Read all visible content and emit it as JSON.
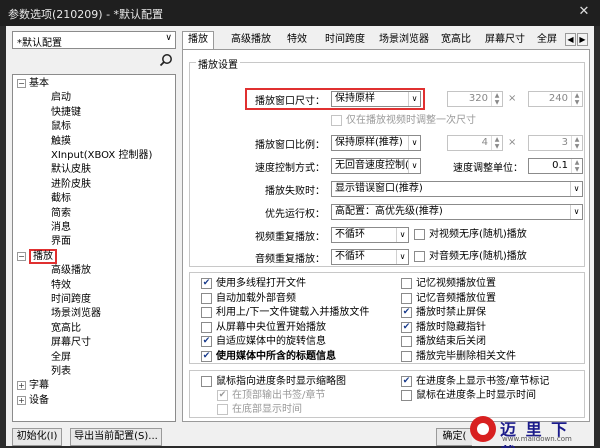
{
  "window": {
    "title": "参数选项(210209) - *默认配置",
    "close": "✕"
  },
  "left": {
    "preset": "*默认配置",
    "search_icon": "search-icon",
    "tree": [
      {
        "label": "基本",
        "expander": "−"
      },
      {
        "label": "启动"
      },
      {
        "label": "快捷键"
      },
      {
        "label": "鼠标"
      },
      {
        "label": "触摸"
      },
      {
        "label": "XInput(XBOX 控制器)"
      },
      {
        "label": "默认皮肤"
      },
      {
        "label": "进阶皮肤"
      },
      {
        "label": "截标"
      },
      {
        "label": "简索"
      },
      {
        "label": "消息"
      },
      {
        "label": "界面"
      },
      {
        "label": "播放",
        "expander": "−",
        "selected": true
      },
      {
        "label": "高级播放"
      },
      {
        "label": "特效"
      },
      {
        "label": "时间跨度"
      },
      {
        "label": "场景浏览器"
      },
      {
        "label": "宽高比"
      },
      {
        "label": "屏幕尺寸"
      },
      {
        "label": "全屏"
      },
      {
        "label": "列表"
      },
      {
        "label": "字幕",
        "expander": "+"
      },
      {
        "label": "设备",
        "expander": "+"
      }
    ]
  },
  "buttons": {
    "init": "初始化(I)",
    "export": "导出当前配置(S)...",
    "ok": "确定("
  },
  "tabs": [
    "播放",
    "高级播放",
    "特效",
    "时间跨度",
    "场景浏览器",
    "宽高比",
    "屏幕尺寸",
    "全屏"
  ],
  "tab_scroll": {
    "left": "◀",
    "right": "▶"
  },
  "settings": {
    "legend": "播放设置",
    "window_size_label": "播放窗口尺寸：",
    "window_size_value": "保持原样",
    "width": "320",
    "height": "240",
    "times": "×",
    "only_when_video": "仅在播放视频时调整一次尺寸",
    "ratio_label": "播放窗口比例：",
    "ratio_value": "保持原样(推荐)",
    "ratio_a": "4",
    "ratio_b": "3",
    "speed_label": "速度控制方式：",
    "speed_value": "无回音速度控制(",
    "speed_unit_label": "速度调整单位：",
    "speed_unit_value": "0.1",
    "fail_label": "播放失败时：",
    "fail_value": "显示错误窗口(推荐)",
    "priority_label": "优先运行权：",
    "priority_value": "高配置：高优先级(推荐)",
    "video_repeat_label": "视频重复播放：",
    "video_repeat_value": "不循环",
    "video_shuffle": "对视频无序(随机)播放",
    "audio_repeat_label": "音频重复播放：",
    "audio_repeat_value": "不循环",
    "audio_shuffle": "对音频无序(随机)播放",
    "arrow": "∨"
  },
  "options_left": [
    {
      "label": "使用多线程打开文件",
      "checked": true
    },
    {
      "label": "自动加载外部音频",
      "checked": false
    },
    {
      "label": "利用上/下一文件键载入并播放文件",
      "checked": false
    },
    {
      "label": "从屏幕中央位置开始播放",
      "checked": false
    },
    {
      "label": "自适应媒体中的旋转信息",
      "checked": true
    },
    {
      "label": "使用媒体中所含的标题信息",
      "checked": true,
      "bold": true
    }
  ],
  "options_right": [
    {
      "label": "记忆视频播放位置",
      "checked": false
    },
    {
      "label": "记忆音频播放位置",
      "checked": false
    },
    {
      "label": "播放时禁止屏保",
      "checked": true
    },
    {
      "label": "播放时隐藏指针",
      "checked": true
    },
    {
      "label": "播放结束后关闭",
      "checked": false
    },
    {
      "label": "播放完毕删除相关文件",
      "checked": false
    }
  ],
  "seek_options": [
    {
      "label": "鼠标指向进度条时显示缩略图",
      "checked": false
    },
    {
      "label": "在顶部输出书签/章节",
      "checked": true,
      "disabled": true
    },
    {
      "label": "在底部显示时间",
      "checked": false,
      "disabled": true
    },
    {
      "label": "在进度条上显示书签/章节标记",
      "checked": true
    },
    {
      "label": "鼠标在进度条上时显示时间",
      "checked": false
    }
  ],
  "check_mark": "✔",
  "watermark": {
    "text": "迈 里 下 载",
    "url": "www.maiidown.com"
  }
}
